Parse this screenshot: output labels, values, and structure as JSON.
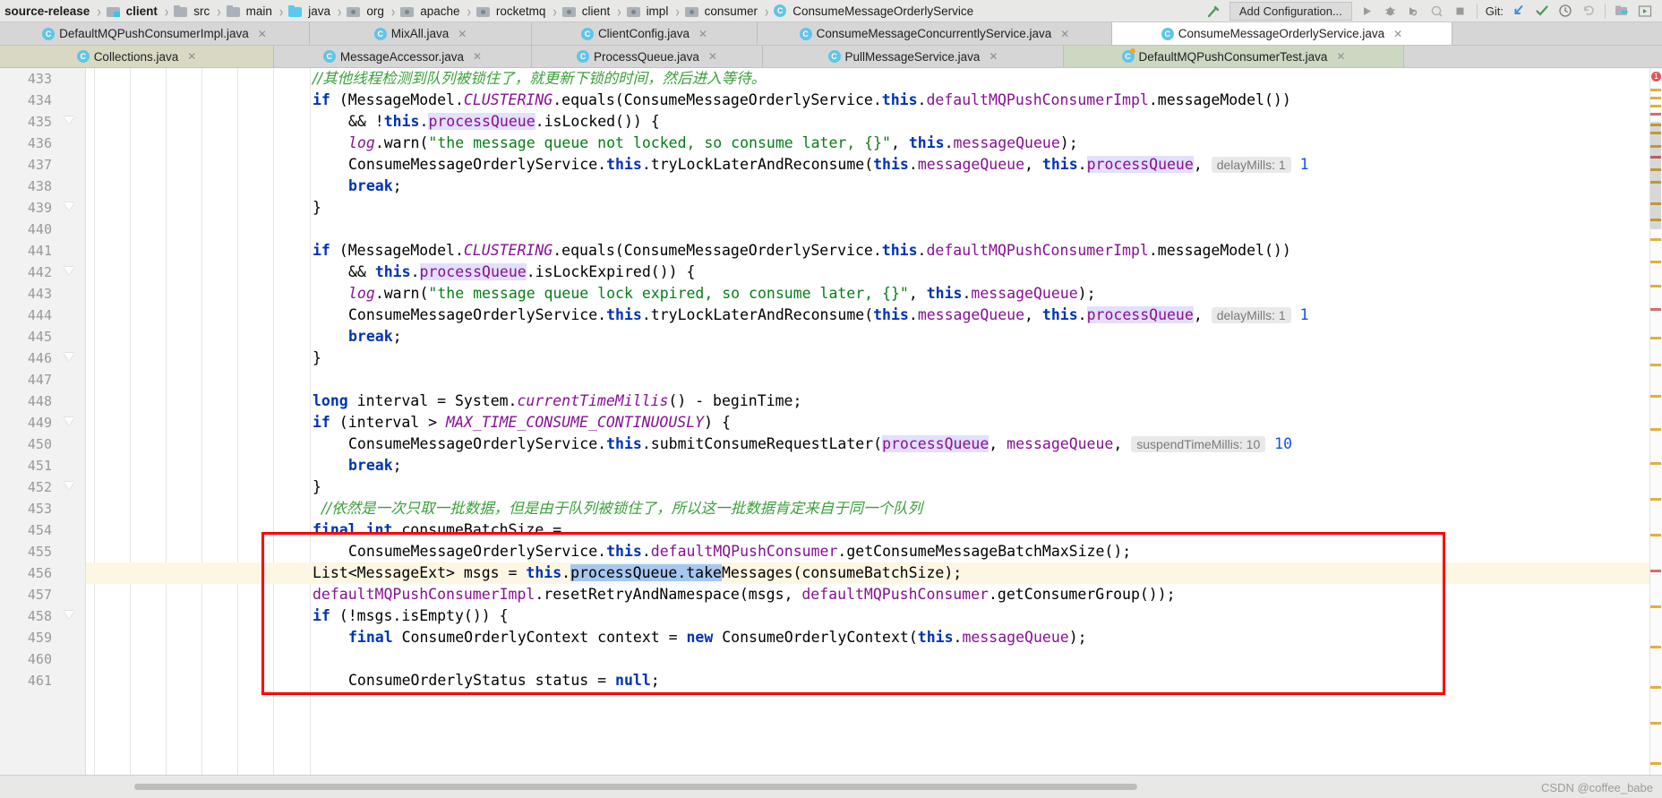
{
  "navbar": {
    "breadcrumbs": [
      {
        "label": "source-release",
        "icon": "none",
        "bold": true
      },
      {
        "label": "client",
        "icon": "folder-module-icon",
        "bold": true
      },
      {
        "label": "src",
        "icon": "folder-icon",
        "bold": false
      },
      {
        "label": "main",
        "icon": "folder-icon",
        "bold": false
      },
      {
        "label": "java",
        "icon": "folder-source-icon",
        "bold": false
      },
      {
        "label": "org",
        "icon": "folder-package-icon",
        "bold": false
      },
      {
        "label": "apache",
        "icon": "folder-package-icon",
        "bold": false
      },
      {
        "label": "rocketmq",
        "icon": "folder-package-icon",
        "bold": false
      },
      {
        "label": "client",
        "icon": "folder-package-icon",
        "bold": false
      },
      {
        "label": "impl",
        "icon": "folder-package-icon",
        "bold": false
      },
      {
        "label": "consumer",
        "icon": "folder-package-icon",
        "bold": false
      },
      {
        "label": "ConsumeMessageOrderlyService",
        "icon": "java-class-icon",
        "bold": false
      }
    ],
    "separator": "›",
    "build_icon": "hammer-icon",
    "run_configuration": "Add Configuration...",
    "run_icon": "run-icon",
    "debug_icon": "debug-icon",
    "coverage_icon": "run-with-coverage-icon",
    "profile_icon": "profile-icon",
    "stop_icon": "stop-icon",
    "git_label": "Git:",
    "git_update_icon": "update-project-icon",
    "git_commit_icon": "commit-icon",
    "git_history_icon": "history-icon",
    "git_rollback_icon": "rollback-icon",
    "search_everywhere_icon": "search-everywhere-icon",
    "project_icon": "project-structure-icon"
  },
  "tabs": {
    "row1": [
      {
        "label": "DefaultMQPushConsumerImpl.java",
        "icon": "java-class-icon",
        "state": "normal",
        "close": "✕"
      },
      {
        "label": "MixAll.java",
        "icon": "java-class-icon",
        "state": "normal",
        "close": "✕"
      },
      {
        "label": "ClientConfig.java",
        "icon": "java-class-icon",
        "state": "normal",
        "close": "✕"
      },
      {
        "label": "ConsumeMessageConcurrentlyService.java",
        "icon": "java-class-icon",
        "state": "normal",
        "close": "✕"
      },
      {
        "label": "ConsumeMessageOrderlyService.java",
        "icon": "java-class-icon",
        "state": "active",
        "close": "✕"
      }
    ],
    "row2": [
      {
        "label": "Collections.java",
        "icon": "java-class-icon",
        "state": "modified",
        "close": "✕"
      },
      {
        "label": "MessageAccessor.java",
        "icon": "java-class-icon",
        "state": "normal",
        "close": "✕"
      },
      {
        "label": "ProcessQueue.java",
        "icon": "java-class-icon",
        "state": "normal",
        "close": "✕"
      },
      {
        "label": "PullMessageService.java",
        "icon": "java-class-icon",
        "state": "normal",
        "close": "✕"
      },
      {
        "label": "DefaultMQPushConsumerTest.java",
        "icon": "java-test-class-icon",
        "state": "testfile",
        "close": "✕"
      }
    ]
  },
  "editor": {
    "first_line": 433,
    "last_line": 461,
    "caret_line": 456,
    "line_numbers": [
      433,
      434,
      435,
      436,
      437,
      438,
      439,
      440,
      441,
      442,
      443,
      444,
      445,
      446,
      447,
      448,
      449,
      450,
      451,
      452,
      453,
      454,
      455,
      456,
      457,
      458,
      459,
      460,
      461
    ],
    "folds": [
      {
        "line": 435,
        "glyph": "−"
      },
      {
        "line": 439,
        "glyph": "−"
      },
      {
        "line": 442,
        "glyph": "−"
      },
      {
        "line": 446,
        "glyph": "−"
      },
      {
        "line": 449,
        "glyph": "−"
      },
      {
        "line": 452,
        "glyph": "−"
      },
      {
        "line": 458,
        "glyph": "−"
      }
    ],
    "inlay_hints": [
      {
        "line": 437,
        "text": "delayMills: 1"
      },
      {
        "line": 444,
        "text": "delayMills: 1"
      },
      {
        "line": 450,
        "text": "suspendTimeMillis: 10"
      }
    ],
    "highlighted_token": "processQueue",
    "annotation_box_color": "#ff0000",
    "error_badge": "1",
    "lines": [
      {
        "n": 433,
        "text": "        //其他线程检测到队列被锁住了，就更新下锁的时间，然后进入等待。"
      },
      {
        "n": 434,
        "text": "        if (MessageModel.CLUSTERING.equals(ConsumeMessageOrderlyService.this.defaultMQPushConsumerImpl.messageModel())"
      },
      {
        "n": 435,
        "text": "            && !this.processQueue.isLocked()) {"
      },
      {
        "n": 436,
        "text": "            log.warn(\"the message queue not locked, so consume later, {}\", this.messageQueue);"
      },
      {
        "n": 437,
        "text": "            ConsumeMessageOrderlyService.this.tryLockLaterAndReconsume(this.messageQueue, this.processQueue, 1"
      },
      {
        "n": 438,
        "text": "            break;"
      },
      {
        "n": 439,
        "text": "        }"
      },
      {
        "n": 440,
        "text": ""
      },
      {
        "n": 441,
        "text": "        if (MessageModel.CLUSTERING.equals(ConsumeMessageOrderlyService.this.defaultMQPushConsumerImpl.messageModel())"
      },
      {
        "n": 442,
        "text": "            && this.processQueue.isLockExpired()) {"
      },
      {
        "n": 443,
        "text": "            log.warn(\"the message queue lock expired, so consume later, {}\", this.messageQueue);"
      },
      {
        "n": 444,
        "text": "            ConsumeMessageOrderlyService.this.tryLockLaterAndReconsume(this.messageQueue, this.processQueue, 1"
      },
      {
        "n": 445,
        "text": "            break;"
      },
      {
        "n": 446,
        "text": "        }"
      },
      {
        "n": 447,
        "text": ""
      },
      {
        "n": 448,
        "text": "        long interval = System.currentTimeMillis() - beginTime;"
      },
      {
        "n": 449,
        "text": "        if (interval > MAX_TIME_CONSUME_CONTINUOUSLY) {"
      },
      {
        "n": 450,
        "text": "            ConsumeMessageOrderlyService.this.submitConsumeRequestLater(processQueue, messageQueue, 10"
      },
      {
        "n": 451,
        "text": "            break;"
      },
      {
        "n": 452,
        "text": "        }"
      },
      {
        "n": 453,
        "text": "        //依然是一次只取一批数据，但是由于队列被锁住了，所以这一批数据肯定来自于同一个队列"
      },
      {
        "n": 454,
        "text": "        final int consumeBatchSize ="
      },
      {
        "n": 455,
        "text": "            ConsumeMessageOrderlyService.this.defaultMQPushConsumer.getConsumeMessageBatchMaxSize();"
      },
      {
        "n": 456,
        "text": "        List<MessageExt> msgs = this.processQueue.takeMessages(consumeBatchSize);"
      },
      {
        "n": 457,
        "text": "        defaultMQPushConsumerImpl.resetRetryAndNamespace(msgs, defaultMQPushConsumer.getConsumerGroup());"
      },
      {
        "n": 458,
        "text": "        if (!msgs.isEmpty()) {"
      },
      {
        "n": 459,
        "text": "            final ConsumeOrderlyContext context = new ConsumeOrderlyContext(this.messageQueue);"
      },
      {
        "n": 460,
        "text": ""
      },
      {
        "n": 461,
        "text": "            ConsumeOrderlyStatus status = null;"
      }
    ]
  },
  "watermark": "CSDN @coffee_babe"
}
